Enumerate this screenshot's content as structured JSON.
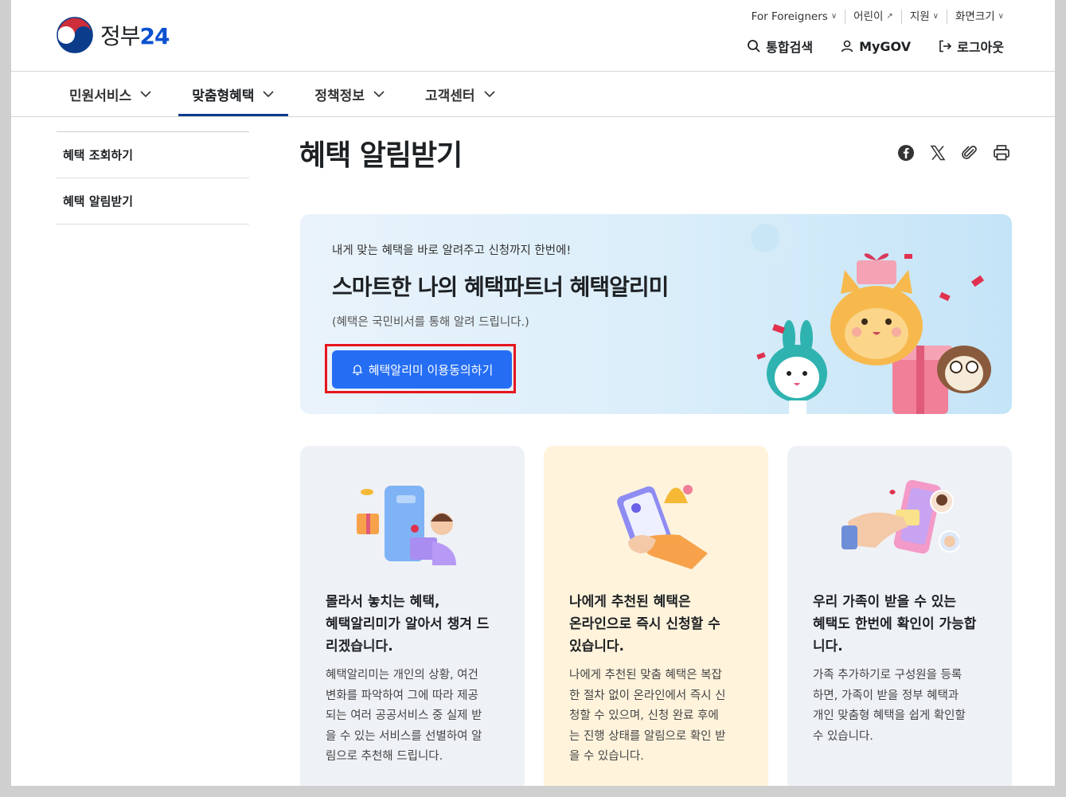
{
  "brand": {
    "logo_text": "정부",
    "logo_num": "24"
  },
  "utility": [
    {
      "label": "For Foreigners",
      "icon": "chevron-down-icon"
    },
    {
      "label": "어린이",
      "icon": "external-link-icon"
    },
    {
      "label": "지원",
      "icon": "chevron-down-icon"
    },
    {
      "label": "화면크기",
      "icon": "chevron-down-icon"
    }
  ],
  "mainlinks": {
    "search": "통합검색",
    "mygov": "MyGOV",
    "logout": "로그아웃"
  },
  "gnb": [
    {
      "label": "민원서비스",
      "active": false
    },
    {
      "label": "맞춤형혜택",
      "active": true
    },
    {
      "label": "정책정보",
      "active": false
    },
    {
      "label": "고객센터",
      "active": false
    }
  ],
  "side": [
    {
      "label": "혜택 조회하기"
    },
    {
      "label": "혜택 알림받기"
    }
  ],
  "page": {
    "title": "혜택 알림받기"
  },
  "share": [
    "facebook-icon",
    "x-icon",
    "link-icon",
    "print-icon"
  ],
  "banner": {
    "sub": "내게 맞는 혜택을 바로 알려주고 신청까지 한번에!",
    "head": "스마트한 나의 혜택파트너 혜택알리미",
    "note": "(혜택은 국민비서를 통해 알려 드립니다.)",
    "cta": "혜택알리미 이용동의하기"
  },
  "cards": [
    {
      "title": "몰라서 놓치는 혜택,\n혜택알리미가 알아서 챙겨 드리겠습니다.",
      "title_l1": "몰라서 놓치는 혜택,",
      "title_l2": "혜택알리미가 알아서 챙겨 드",
      "title_l3": "리겠습니다.",
      "desc_l1": "혜택알리미는 개인의 상황, 여건",
      "desc_l2": "변화를 파악하여 그에 따라 제공",
      "desc_l3": "되는 여러 공공서비스 중 실제 받",
      "desc_l4": "을 수 있는 서비스를 선별하여 알",
      "desc_l5": "림으로 추천해 드립니다."
    },
    {
      "title_l1": "나에게 추천된 혜택은",
      "title_l2": "온라인으로 즉시 신청할 수",
      "title_l3": "있습니다.",
      "desc_l1": "나에게 추천된 맞춤 혜택은 복잡",
      "desc_l2": "한 절차 없이 온라인에서 즉시 신",
      "desc_l3": "청할 수 있으며, 신청 완료 후에",
      "desc_l4": "는 진행 상태를 알림으로 확인 받",
      "desc_l5": "을 수 있습니다."
    },
    {
      "title_l1": "우리 가족이 받을 수 있는",
      "title_l2": "혜택도 한번에 확인이 가능합",
      "title_l3": "니다.",
      "desc_l1": "가족 추가하기로 구성원을 등록",
      "desc_l2": "하면, 가족이 받을 정부 혜택과",
      "desc_l3": "개인 맞춤형 혜택을 쉽게 확인할",
      "desc_l4": "수 있습니다.",
      "desc_l5": ""
    }
  ],
  "colors": {
    "primary": "#256ef4",
    "highlight": "#e8141c",
    "nav_active": "#0b3c8a"
  }
}
